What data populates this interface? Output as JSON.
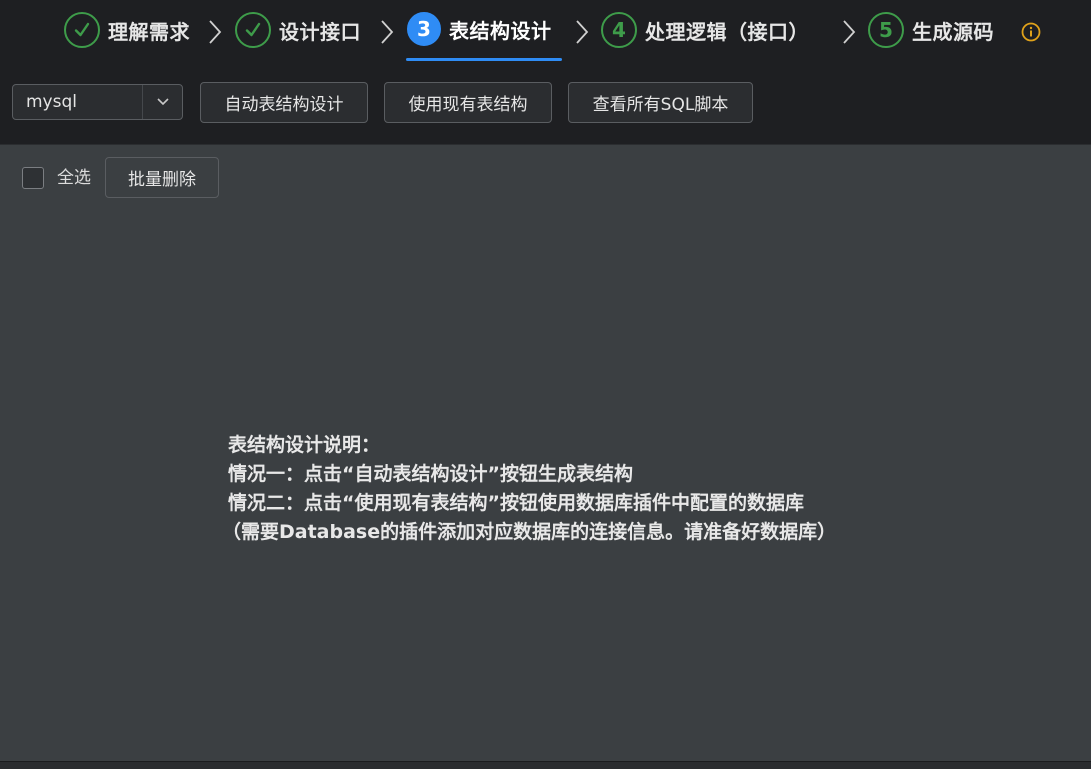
{
  "steps": [
    {
      "label": "理解需求",
      "state": "done",
      "icon": "check-icon"
    },
    {
      "label": "设计接口",
      "state": "done",
      "icon": "check-icon"
    },
    {
      "label": "表结构设计",
      "state": "active",
      "number": "3"
    },
    {
      "label": "处理逻辑（接口）",
      "state": "pending",
      "number": "4"
    },
    {
      "label": "生成源码",
      "state": "pending",
      "number": "5"
    }
  ],
  "toolbar": {
    "db_select_value": "mysql",
    "auto_design_label": "自动表结构设计",
    "use_existing_label": "使用现有表结构",
    "view_sql_label": "查看所有SQL脚本"
  },
  "list_actions": {
    "select_all_label": "全选",
    "batch_delete_label": "批量删除"
  },
  "description": {
    "title": "表结构设计说明：",
    "line1": "情况一：点击“自动表结构设计”按钮生成表结构",
    "line2": "情况二：点击“使用现有表结构”按钮使用数据库插件中配置的数据库",
    "line3": "（需要Database的插件添加对应数据库的连接信息。请准备好数据库）"
  },
  "colors": {
    "done": "#3e9c4a",
    "active": "#2f8cf5",
    "info": "#e0a21a",
    "header_bg": "#1e1f22",
    "content_bg": "#3b3f42"
  }
}
